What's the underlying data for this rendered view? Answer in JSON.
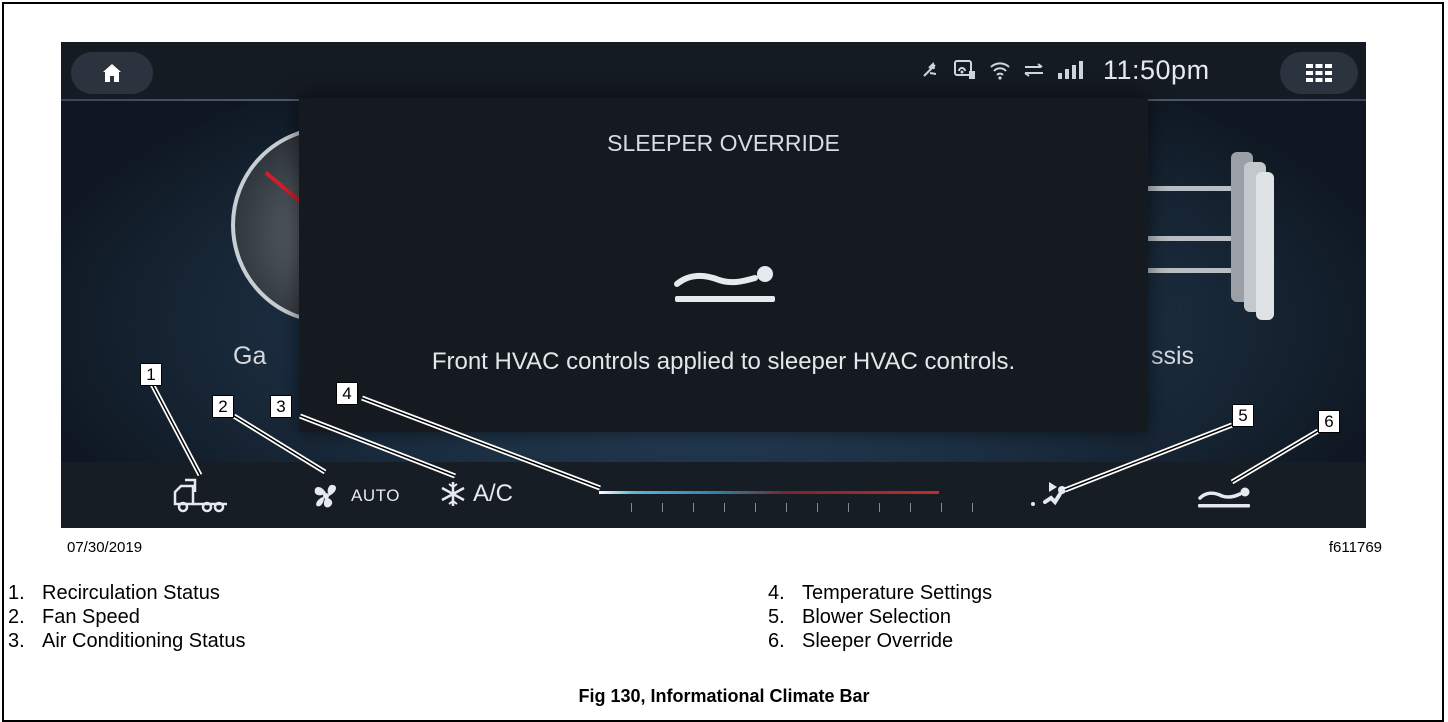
{
  "screen": {
    "clock": "11:50pm",
    "overlay": {
      "title": "SLEEPER OVERRIDE",
      "message": "Front HVAC controls applied to sleeper HVAC controls."
    },
    "bg_labels": {
      "left": "Ga",
      "right": "ssis"
    },
    "bottombar": {
      "fan_mode": "AUTO",
      "ac_label": "A/C"
    },
    "icons": [
      "home-icon",
      "mute-icon",
      "vehicle-connect-icon",
      "wifi-icon",
      "transfer-icon",
      "signal-icon",
      "apps-grid-icon",
      "recirculation-icon",
      "fan-icon",
      "snowflake-icon",
      "blower-icon",
      "sleeper-icon"
    ]
  },
  "callouts": [
    "1",
    "2",
    "3",
    "4",
    "5",
    "6"
  ],
  "date": "07/30/2019",
  "figure_id": "f611769",
  "legend": [
    {
      "num": "1.",
      "text": "Recirculation Status"
    },
    {
      "num": "2.",
      "text": "Fan Speed"
    },
    {
      "num": "3.",
      "text": "Air Conditioning Status"
    },
    {
      "num": "4.",
      "text": "Temperature Settings"
    },
    {
      "num": "5.",
      "text": "Blower Selection"
    },
    {
      "num": "6.",
      "text": "Sleeper Override"
    }
  ],
  "caption": "Fig 130, Informational Climate Bar",
  "colors": {
    "screen_bg": "#1a222c",
    "temp_cold": "#59b7d9",
    "temp_hot": "#c22b2b",
    "needle": "#d0202a"
  }
}
